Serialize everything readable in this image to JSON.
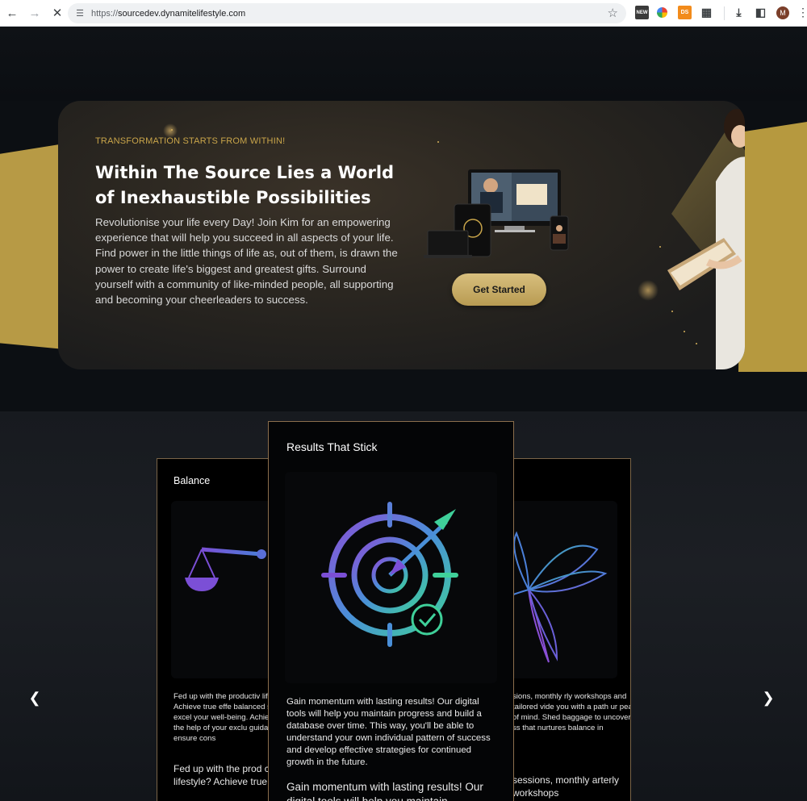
{
  "browser": {
    "url_scheme": "https://",
    "url_host": "sourcedev.dynamitelifestyle.com",
    "ext_new_label": "NEW",
    "ext_ds_label": "DS",
    "avatar_letter": "M"
  },
  "hero": {
    "eyebrow": "TRANSFORMATION STARTS FROM WITHIN!",
    "title": "Within The Source Lies a World of Inexhaustible Possibilities",
    "description": "Revolutionise your life every Day! Join Kim for an empowering experience that will help you succeed in all aspects of your life. Find power in the little things of life as, out of them, is drawn the power to create life's biggest and greatest gifts. Surround yourself with a community of like-minded people, all supporting and becoming your cheerleaders to success.",
    "cta_label": "Get Started"
  },
  "cards": {
    "left": {
      "title": "Balance",
      "icon": "scale-icon",
      "body_small": "Fed up with the productiv lifestyle? Achieve true effe balanced so you can excel your well-being. Achieve lo with the help of your exclu guidance will ensure cons",
      "body_large": "Fed up with the prod costs lifestyle? Achieve true effective"
    },
    "center": {
      "title": "Results That Stick",
      "icon": "target-icon",
      "body": "Gain momentum with lasting results! Our digital tools will help you maintain progress and build a database over time. This way, you'll be able to understand your own individual pattern of success and develop effective strategies for continued growth in the future.",
      "body_repeat": "Gain momentum with lasting results! Our digital tools will help you maintain"
    },
    "right": {
      "icon": "butterfly-icon",
      "body_small": "sions, monthly rly workshops and tailored vide you with a path ur peace of mind. Shed baggage to uncover an ss that nurtures balance in",
      "body_large": "sessions, monthly arterly workshops"
    }
  },
  "carousel": {
    "prev_icon": "chevron-left-icon",
    "next_icon": "chevron-right-icon"
  }
}
